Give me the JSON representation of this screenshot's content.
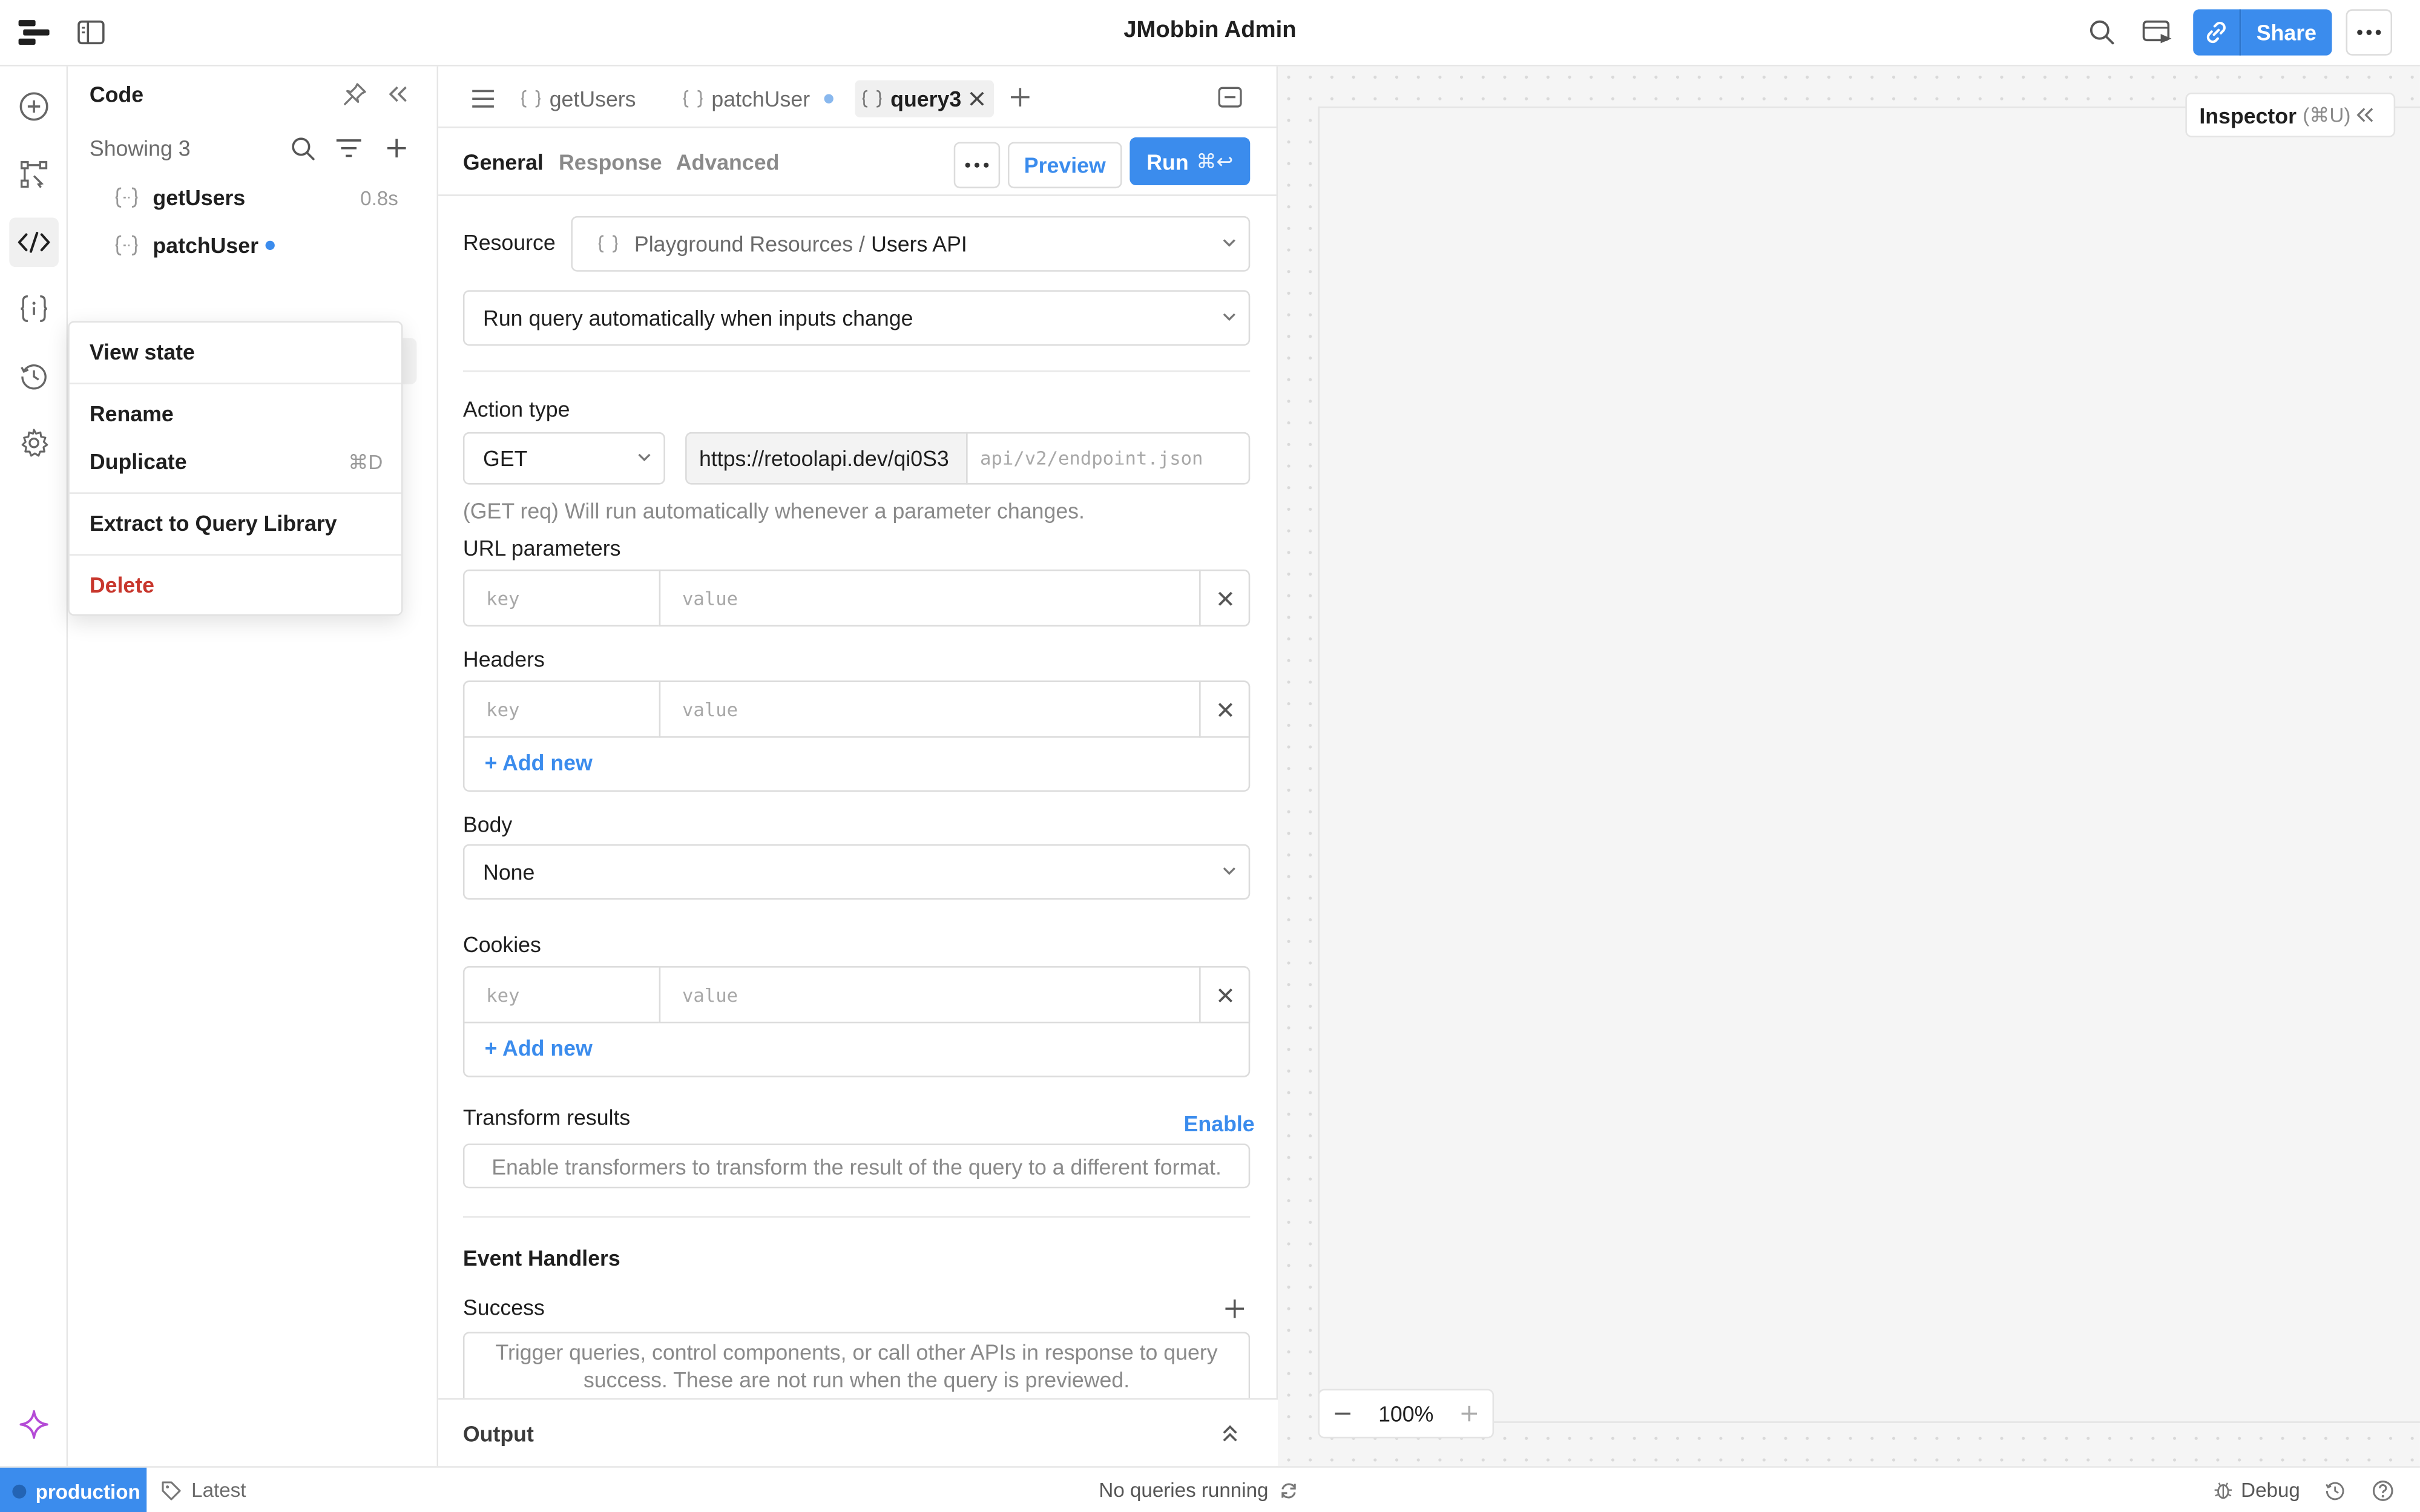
{
  "app": {
    "title": "JMobbin Admin"
  },
  "topbar": {
    "share_label": "Share"
  },
  "code_panel": {
    "title": "Code",
    "showing": "Showing 3",
    "queries": [
      {
        "name": "getUsers",
        "time": "0.8s"
      },
      {
        "name": "patchUser",
        "time": ""
      },
      {
        "name": "query3",
        "time": ""
      }
    ]
  },
  "context_menu": {
    "view_state": "View state",
    "rename": "Rename",
    "duplicate": "Duplicate",
    "duplicate_shortcut": "⌘D",
    "extract": "Extract to Query Library",
    "delete": "Delete"
  },
  "editor": {
    "tabs": [
      "getUsers",
      "patchUser",
      "query3"
    ],
    "subtabs": [
      "General",
      "Response",
      "Advanced"
    ],
    "preview_label": "Preview",
    "run_label": "Run",
    "run_shortcut": "⌘↩",
    "resource_label": "Resource",
    "resource_prefix": "Playground Resources /",
    "resource_name": "Users API",
    "run_mode": "Run query automatically when inputs change",
    "action_type_label": "Action type",
    "method": "GET",
    "base_url": "https://retoolapi.dev/qi0S3",
    "endpoint_placeholder": "api/v2/endpoint.json",
    "get_note": "(GET req) Will run automatically whenever a parameter changes.",
    "url_params_label": "URL parameters",
    "headers_label": "Headers",
    "body_label": "Body",
    "body_value": "None",
    "cookies_label": "Cookies",
    "key_placeholder": "key",
    "value_placeholder": "value",
    "add_new": "+ Add new",
    "transform_label": "Transform results",
    "enable_label": "Enable",
    "transform_placeholder": "Enable transformers to transform the result of the query to a different format.",
    "event_handlers_label": "Event Handlers",
    "success_label": "Success",
    "success_note": "Trigger queries, control components, or call other APIs in response to query success. These are not run when the query is previewed.",
    "output_label": "Output"
  },
  "canvas": {
    "inspector_label": "Inspector",
    "inspector_shortcut": "(⌘U)",
    "zoom": "100%"
  },
  "statusbar": {
    "environment": "production",
    "version": "Latest",
    "status": "No queries running",
    "debug": "Debug"
  },
  "colors": {
    "accent": "#3b8ced",
    "danger": "#c8372d",
    "ai": "#b44bd6"
  }
}
